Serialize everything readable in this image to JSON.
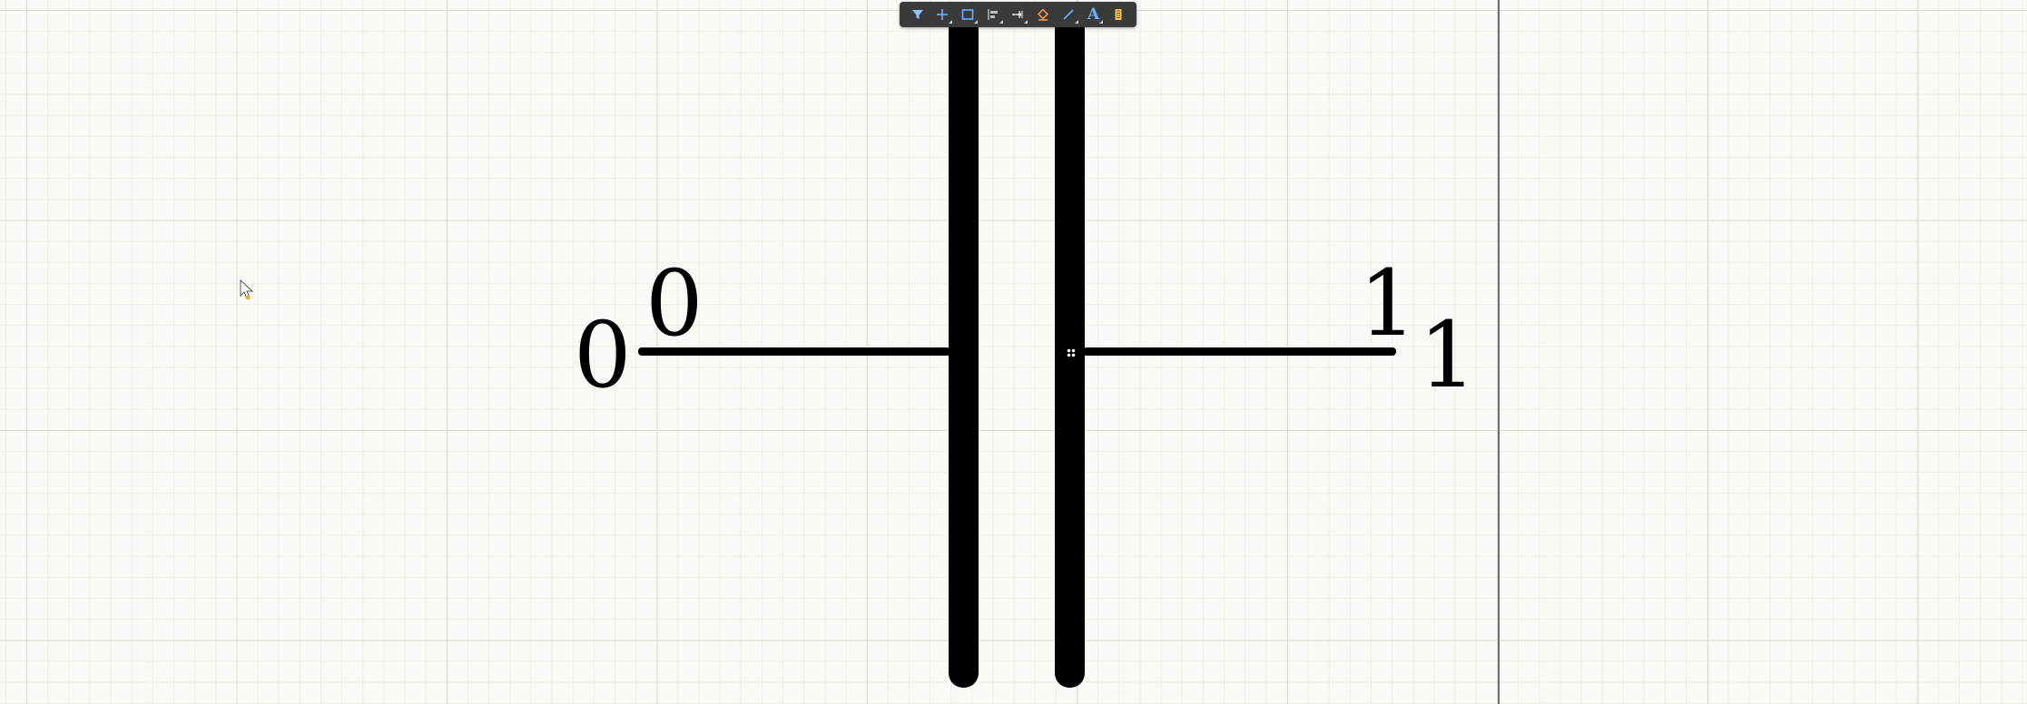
{
  "canvas": {
    "background_color": "#fcfaf6",
    "grid_color": "#ddd9d3",
    "subgrid_color": "#f1ede7",
    "border_color": "#6e6e6e"
  },
  "toolbar": {
    "buttons": [
      {
        "name": "filter-icon",
        "has_menu": false
      },
      {
        "name": "crosshair-icon",
        "has_menu": true
      },
      {
        "name": "rectangle-select-icon",
        "has_menu": true
      },
      {
        "name": "align-icon",
        "has_menu": true
      },
      {
        "name": "place-pin-icon",
        "has_menu": true
      },
      {
        "name": "fill-color-icon",
        "has_menu": false
      },
      {
        "name": "line-icon",
        "has_menu": true
      },
      {
        "name": "text-icon",
        "has_menu": true,
        "letter": "A"
      },
      {
        "name": "component-icon",
        "has_menu": false
      }
    ]
  },
  "symbol": {
    "type": "capacitor",
    "color": "#000000",
    "pins": [
      {
        "designator": "0",
        "name": "0"
      },
      {
        "designator": "1",
        "name": "1"
      }
    ]
  },
  "cursor": {
    "icon": "pointer-cursor-icon"
  }
}
